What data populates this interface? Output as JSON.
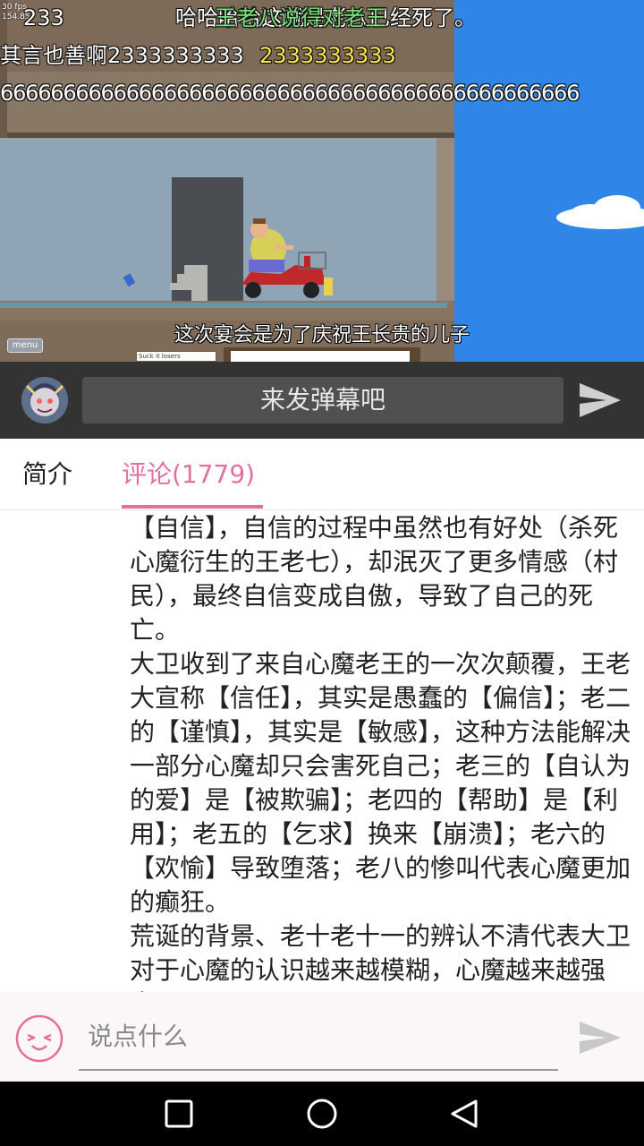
{
  "video": {
    "fps_text": [
      "30 fps",
      "154.85"
    ],
    "danmaku": [
      {
        "text": "233",
        "color": "#ffffff"
      },
      {
        "text": "哈哈哈哈这就是老八已经死了。",
        "color": "#ffffff"
      },
      {
        "text": "王老八说得对老王",
        "color": "#7ae27a"
      },
      {
        "text": "其言也善啊2333333333",
        "color": "#ffffff"
      },
      {
        "text": "2333333333",
        "color": "#ffe84a"
      },
      {
        "text": "6666666666666666666666666666666666666666666666",
        "color": "#ffffff"
      }
    ],
    "subtitle": "这次宴会是为了庆祝王长贵的儿子",
    "menu_label": "menu",
    "sign_text": "Suck it losers"
  },
  "danmaku_bar": {
    "placeholder": "来发弹幕吧",
    "send_icon": "send-icon"
  },
  "tabs": {
    "intro_label": "简介",
    "comments_label": "评论(1779)",
    "active": "comments",
    "accent_color": "#e56f9c"
  },
  "comment": {
    "paragraphs": [
      "【自信】，自信的过程中虽然也有好处（杀死心魔衍生的王老七），却泯灭了更多情感（村民），最终自信变成自傲，导致了自己的死亡。",
      "大卫收到了来自心魔老王的一次次颠覆，王老大宣称【信任】，其实是愚蠢的【偏信】；老二的【谨慎】，其实是【敏感】，这种方法能解决一部分心魔却只会害死自己；老三的【自认为的爱】是【被欺骗】；老四的【帮助】是【利用】；老五的【乞求】换来【崩溃】；老六的【欢愉】导致堕落；老八的惨叫代表心魔更加的癫狂。",
      "荒诞的背景、老十老十一的辨认不清代表大卫对于心魔的认识越来越模糊，心魔越来越强大。"
    ]
  },
  "comment_bar": {
    "placeholder": "说点什么",
    "emoji_icon": "emoji-icon",
    "send_icon": "send-icon"
  },
  "nav": {
    "recent_icon": "square-recent-apps-icon",
    "home_icon": "circle-home-icon",
    "back_icon": "triangle-back-icon"
  }
}
